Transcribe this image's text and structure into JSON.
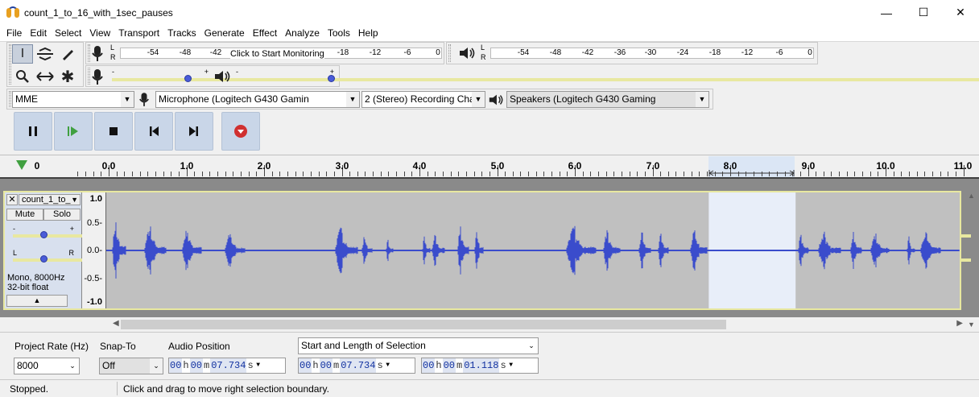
{
  "window": {
    "title": "count_1_to_16_with_1sec_pauses",
    "minimize": "—",
    "maximize": "☐",
    "close": "✕"
  },
  "menu": [
    "File",
    "Edit",
    "Select",
    "View",
    "Transport",
    "Tracks",
    "Generate",
    "Effect",
    "Analyze",
    "Tools",
    "Help"
  ],
  "recording_meter": {
    "lr": "L\nR",
    "ticks": [
      "-54",
      "-48",
      "-42",
      "-18",
      "-12",
      "-6",
      "0"
    ],
    "hint": "Click to Start Monitoring"
  },
  "playback_meter": {
    "ticks": [
      "-54",
      "-48",
      "-42",
      "-36",
      "-30",
      "-24",
      "-18",
      "-12",
      "-6",
      "0"
    ]
  },
  "mixer": {
    "rec_minus": "-",
    "rec_plus": "+",
    "play_minus": "-",
    "play_plus": "+"
  },
  "device_toolbar": {
    "host": "MME",
    "input_device": "Microphone (Logitech G430 Gamin",
    "channels": "2 (Stereo) Recording Chai",
    "output_device": "Speakers (Logitech G430 Gaming"
  },
  "timeline": {
    "labels": [
      "0",
      "0.0",
      "1.0",
      "2.0",
      "3.0",
      "4.0",
      "5.0",
      "6.0",
      "7.0",
      "8.0",
      "9.0",
      "10.0",
      "11.0"
    ]
  },
  "track": {
    "name": "count_1_to_",
    "mute": "Mute",
    "solo": "Solo",
    "gain_minus": "-",
    "gain_plus": "+",
    "pan_left": "L",
    "pan_right": "R",
    "info_rate": "Mono, 8000Hz",
    "info_format": "32-bit float",
    "collapse": "▲",
    "ruler": [
      "1.0",
      "0.5-",
      "0.0-",
      "-0.5-",
      "-1.0"
    ],
    "selection_start": 7.734,
    "selection_length": 1.118
  },
  "selection_bar": {
    "project_rate_label": "Project Rate (Hz)",
    "project_rate": "8000",
    "snap_to_label": "Snap-To",
    "snap_to": "Off",
    "audio_position_label": "Audio Position",
    "selection_mode": "Start and Length of Selection",
    "audio_position": {
      "h": "00",
      "m": "00",
      "s": "07.734"
    },
    "sel_start": {
      "h": "00",
      "m": "00",
      "s": "07.734"
    },
    "sel_length": {
      "h": "00",
      "m": "00",
      "s": "01.118"
    },
    "unit_h": "h",
    "unit_m": "m",
    "unit_s": "s"
  },
  "status": {
    "state": "Stopped.",
    "message": "Click and drag to move right selection boundary."
  },
  "colors": {
    "waveform": "#3a4ccc",
    "waveform_bg": "#c0c0c0",
    "selection": "#e8eef9",
    "transport_btn": "#c9d6e8",
    "record": "#d03030"
  }
}
